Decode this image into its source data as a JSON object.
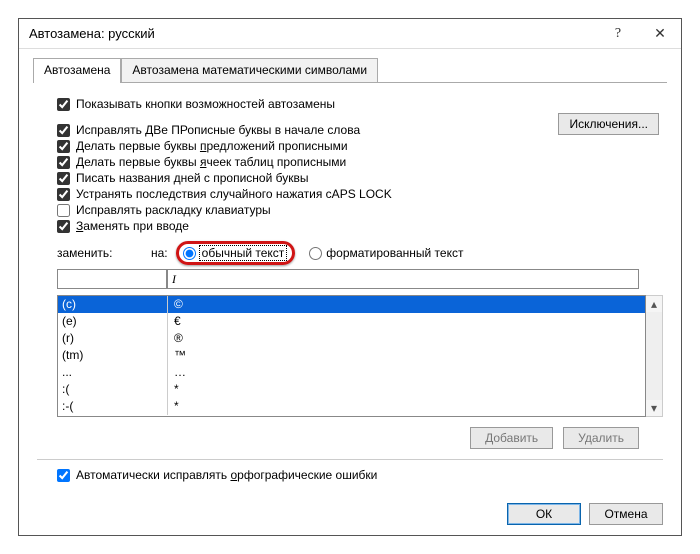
{
  "titlebar": {
    "title": "Автозамена: русский",
    "help": "?",
    "close": "✕"
  },
  "tabs": {
    "autocorrect": "Автозамена",
    "math": "Автозамена математическими символами"
  },
  "checks": {
    "show_buttons": "Показывать кнопки возможностей автозамены",
    "two_caps": "Исправлять ДВе ПРописные буквы в начале слова",
    "sentence_caps": "Делать первые буквы предложений прописными",
    "cell_caps": "Делать первые буквы ячеек таблиц прописными",
    "day_caps": "Писать названия дней с прописной буквы",
    "caps_lock": "Устранять последствия случайного нажатия cAPS LOCK",
    "keyboard_layout": "Исправлять раскладку клавиатуры",
    "replace_as_type": "Заменять при вводе",
    "auto_spell": "Автоматически исправлять орфографические ошибки"
  },
  "exceptions_btn": "Исключения...",
  "replace_labels": {
    "replace": "заменить:",
    "with": "на:",
    "plain_text": "обычный текст",
    "formatted_text": "форматированный текст"
  },
  "inputs": {
    "replace_value": "",
    "with_value": "I"
  },
  "listbox": [
    {
      "from": "(c)",
      "to": "©"
    },
    {
      "from": "(e)",
      "to": "€"
    },
    {
      "from": "(r)",
      "to": "®"
    },
    {
      "from": "(tm)",
      "to": "™"
    },
    {
      "from": "...",
      "to": "…"
    },
    {
      "from": ":(",
      "to": "*"
    },
    {
      "from": ":-(",
      "to": "*"
    }
  ],
  "selected_row_index": 0,
  "buttons": {
    "add": "Добавить",
    "delete": "Удалить",
    "ok": "ОК",
    "cancel": "Отмена"
  }
}
